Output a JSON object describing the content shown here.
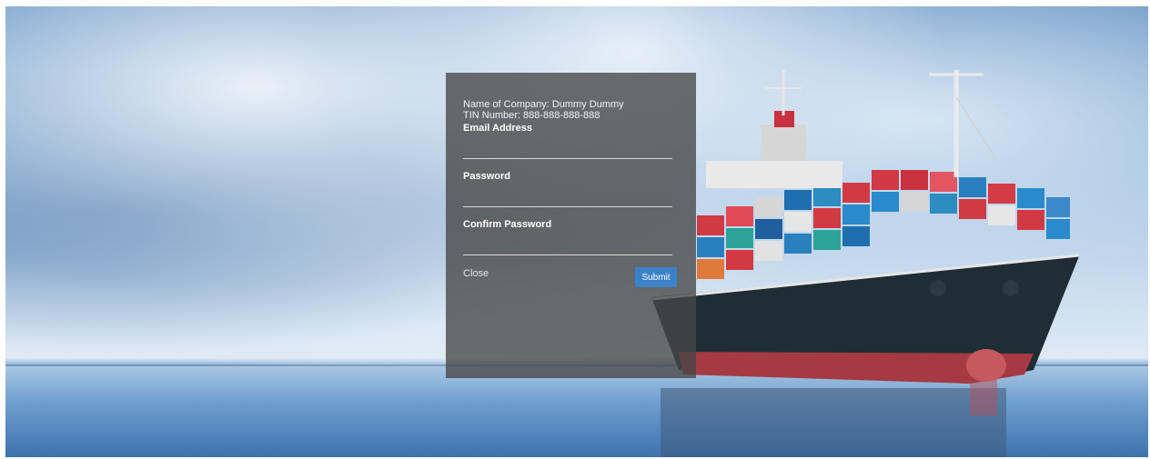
{
  "form": {
    "company_line": "Name of Company: Dummy Dummy",
    "tin_line": "TIN Number: 888-888-888-888",
    "email_label": "Email Address",
    "email_value": "",
    "password_label": "Password",
    "password_value": "",
    "confirm_password_label": "Confirm Password",
    "confirm_password_value": "",
    "close_label": "Close",
    "submit_label": "Submit"
  },
  "colors": {
    "panel_bg": "#464646",
    "submit_bg": "#3c82c9",
    "input_underline": "#d9d9d9"
  }
}
